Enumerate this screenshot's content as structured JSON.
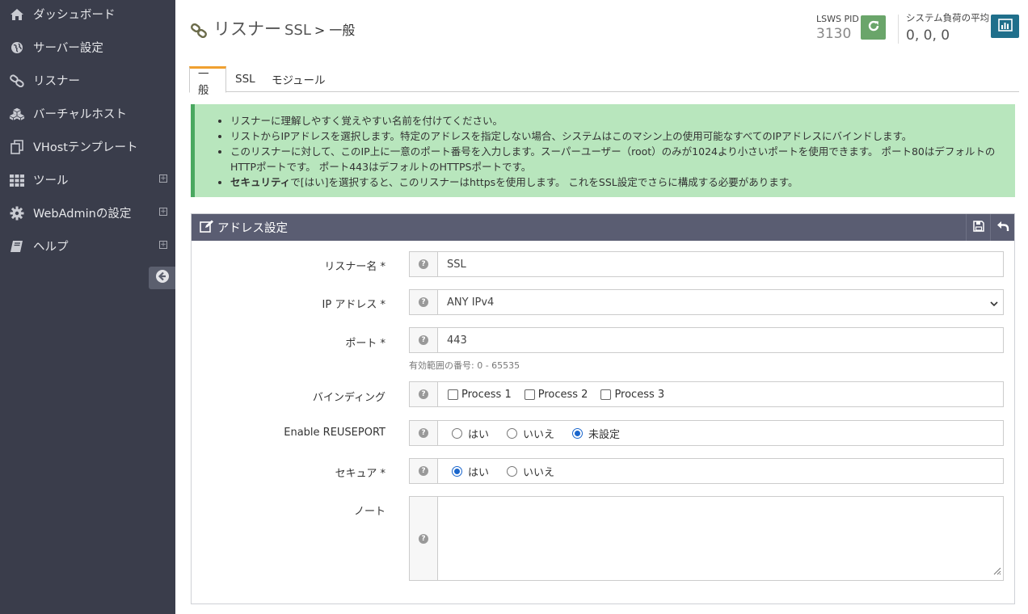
{
  "sidebar": {
    "items": [
      {
        "label": "ダッシュボード",
        "icon": "home-icon",
        "expand": ""
      },
      {
        "label": "サーバー設定",
        "icon": "globe-icon",
        "expand": ""
      },
      {
        "label": "リスナー",
        "icon": "link-icon",
        "expand": ""
      },
      {
        "label": "バーチャルホスト",
        "icon": "cubes-icon",
        "expand": ""
      },
      {
        "label": "VHostテンプレート",
        "icon": "copy-icon",
        "expand": ""
      },
      {
        "label": "ツール",
        "icon": "grid-icon",
        "expand": "+"
      },
      {
        "label": "WebAdminの設定",
        "icon": "gear-icon",
        "expand": "+"
      },
      {
        "label": "ヘルプ",
        "icon": "book-icon",
        "expand": "+"
      }
    ]
  },
  "header": {
    "title": "リスナー",
    "subtitle": "SSL",
    "breadcrumb": "> 一般",
    "pid_label": "LSWS PID",
    "pid_value": "3130",
    "load_label": "システム負荷の平均",
    "load_value": "0, 0, 0"
  },
  "tabs": [
    {
      "label": "一般",
      "active": true
    },
    {
      "label": "SSL",
      "active": false
    },
    {
      "label": "モジュール",
      "active": false
    }
  ],
  "alert": {
    "items": [
      "リスナーに理解しやすく覚えやすい名前を付けてください。",
      "リストからIPアドレスを選択します。特定のアドレスを指定しない場合、システムはこのマシン上の使用可能なすべてのIPアドレスにバインドします。",
      "このリスナーに対して、このIP上に一意のポート番号を入力します。スーパーユーザー（root）のみが1024より小さいポートを使用できます。 ポート80はデフォルトのHTTPポートです。 ポート443はデフォルトのHTTPSポートです。"
    ],
    "last_bold": "セキュリティ",
    "last_rest": "で[はい]を選択すると、このリスナーはhttpsを使用します。 これをSSL設定でさらに構成する必要があります。"
  },
  "panel": {
    "title": "アドレス設定",
    "fields": {
      "name_label": "リスナー名 *",
      "name_value": "SSL",
      "ip_label": "IP アドレス *",
      "ip_value": "ANY IPv4",
      "port_label": "ポート *",
      "port_value": "443",
      "port_hint": "有効範囲の番号: 0 - 65535",
      "binding_label": "バインディング",
      "binding_options": [
        "Process 1",
        "Process 2",
        "Process 3"
      ],
      "reuse_label": "Enable REUSEPORT",
      "reuse_options": [
        "はい",
        "いいえ",
        "未設定"
      ],
      "reuse_selected": "未設定",
      "secure_label": "セキュア *",
      "secure_options": [
        "はい",
        "いいえ"
      ],
      "secure_selected": "はい",
      "note_label": "ノート",
      "note_value": ""
    }
  },
  "colors": {
    "sidebar_bg": "#3a3d4b",
    "refresh_btn": "#6aa56a",
    "chart_btn": "#1f6f8b",
    "alert_bg": "#b8e6bd",
    "panel_head": "#5a5d72",
    "tab_accent": "#f0a030"
  }
}
